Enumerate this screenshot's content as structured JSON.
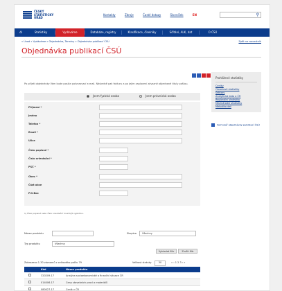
{
  "header": {
    "logo_lines": [
      "ČESKÝ",
      "STATISTICKÝ",
      "ÚŘAD"
    ],
    "links": [
      "Kontakty",
      "Zdroje",
      "Časté dotazy",
      "Slovníček"
    ],
    "lang": "EN"
  },
  "nav": {
    "items": [
      "Statistiky",
      "Vydáváme",
      "Databáze, registry",
      "Klasifikace, číselníky",
      "Sčítání, ALK, dat",
      "O ČSÚ"
    ],
    "active_index": 1
  },
  "breadcrumb": "» Úvod » Vydáváme » Objednávka, Termíny » Objednávka publikací ČSÚ",
  "breadcrumb_right": "Zpět na rozcestník",
  "page_title": "Objednávka publikací ČSÚ",
  "intro_text": "Po přijetí objednávky Vám bude poslán potvrzovací e-mail. Následně pak fakturu a po jejím zaplacení závazné objednané tituly poštou.",
  "person_type": {
    "options": [
      "Jsem fyzická osoba",
      "Jsem právnická osoba"
    ],
    "selected_index": 0
  },
  "form_fields": [
    "Příjmení *",
    "Jméno",
    "Telefon *",
    "Email *",
    "Ulice",
    "Číslo popisné *",
    "Číslo orientační *",
    "PSČ *",
    "Obec *",
    "Část obce",
    "P.O.Box"
  ],
  "form_note": "1) Číslo popisné nebo číslo orientační musí být vyplněno.",
  "sidebar": {
    "title": "Prohlížené statistiky",
    "links": [
      "Ceníky",
      "Obsahové statistiky",
      "Sektory",
      "Analytická data o ČR",
      "Regionální statistiky",
      "Mezinárodní statistiky",
      "Metodika dat"
    ]
  },
  "form_link": "Formulář objednávky publikací ČSÚ",
  "filters": {
    "name_label": "Název produktu",
    "group_label": "Skupina",
    "group_value": "Všechny",
    "type_label": "Typ produktu",
    "type_value": "Všechny",
    "search_button": "Vyhledat filtr",
    "reset_button": "Zrušit filtr"
  },
  "table": {
    "info": "Zobrazeno 1-30 záznamů z celkového počtu 79",
    "per_page_label": "Velikost stránky",
    "per_page": "30",
    "pagination": "« ‹ 1 2 3 › »",
    "headers": [
      "Kód",
      "Název produktu"
    ],
    "rows": [
      [
        "320209-17",
        "Analýza socioekonomické a finanční situace ČR"
      ],
      [
        "014006-17",
        "Ceny stavebních prací a materiálů"
      ],
      [
        "080027-17",
        "Ceník v ČR"
      ]
    ]
  },
  "colors": {
    "brand_blue": "#0b3c8c",
    "accent_red": "#d2232a"
  }
}
